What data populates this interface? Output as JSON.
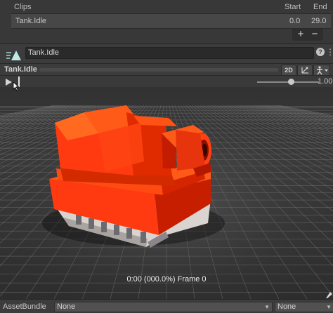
{
  "clips": {
    "header": {
      "title": "Clips",
      "start": "Start",
      "end": "End"
    },
    "rows": [
      {
        "name": "Tank.Idle",
        "start": "0.0",
        "end": "29.0"
      }
    ],
    "add_label": "+",
    "remove_label": "−"
  },
  "preview": {
    "name_value": "Tank.Idle",
    "title": "Tank.Idle",
    "two_d_label": "2D",
    "speed_value": "1.00",
    "speed_fraction": 0.55,
    "frame_readout": "0:00 (000.0%) Frame 0"
  },
  "footer": {
    "label": "AssetBundle",
    "bundle_value": "None",
    "variant_value": "None"
  },
  "colors": {
    "tank_body": "#ff3a10",
    "tank_top": "#ff5a18",
    "grid_background": "#2b2b2b"
  }
}
